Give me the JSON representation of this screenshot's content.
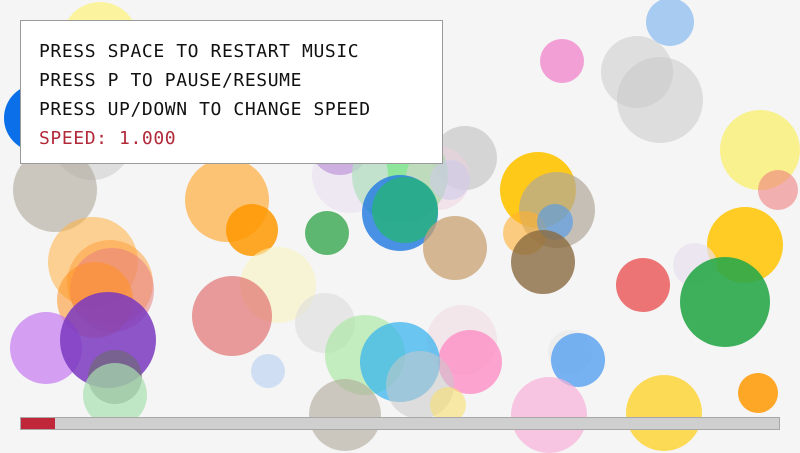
{
  "instructions": [
    "PRESS SPACE TO RESTART MUSIC",
    "PRESS P TO PAUSE/RESUME",
    "PRESS UP/DOWN TO CHANGE SPEED"
  ],
  "speed_text": "SPEED: 1.000",
  "progress": 0.045,
  "colors": {
    "background": "#f5f5f5",
    "speed_text": "#b22a3a",
    "progress_fill": "#c0283a",
    "progress_track": "#cfcfcf"
  }
}
